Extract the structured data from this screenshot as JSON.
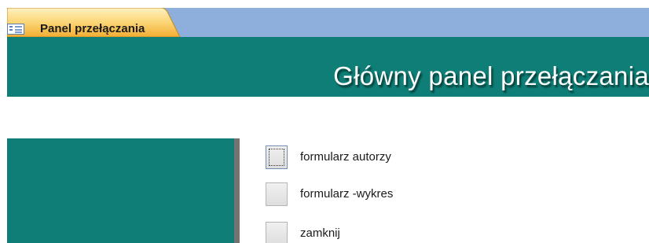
{
  "tab": {
    "label": "Panel przełączania",
    "icon": "form-icon"
  },
  "header": {
    "title": "Główny panel przełączania"
  },
  "menu": {
    "items": [
      {
        "label": "formularz autorzy",
        "focused": true
      },
      {
        "label": "formularz -wykres",
        "focused": false
      },
      {
        "label": "zamknij",
        "focused": false
      }
    ]
  },
  "colors": {
    "tab_bar": "#8eaedb",
    "tab_active_top": "#fde8a8",
    "tab_active_bottom": "#f4b53c",
    "teal": "#0e7e76",
    "panel_border": "#737373"
  }
}
